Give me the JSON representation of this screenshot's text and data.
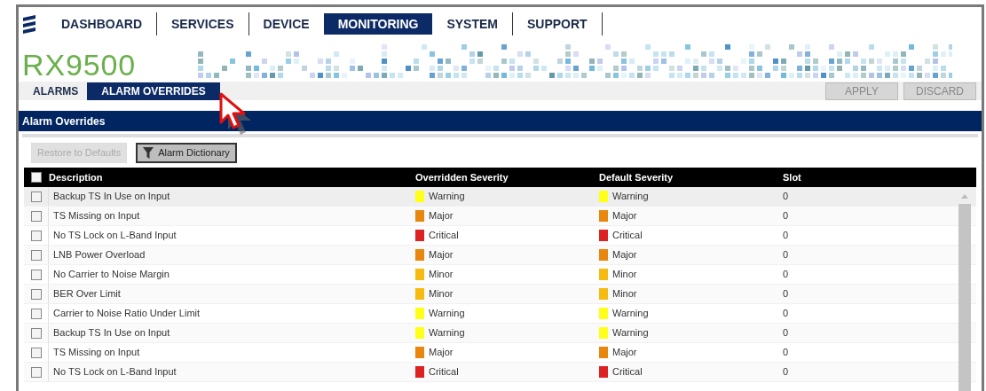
{
  "nav": {
    "tabs": [
      {
        "label": "DASHBOARD",
        "selected": false
      },
      {
        "label": "SERVICES",
        "selected": false
      },
      {
        "label": "DEVICE",
        "selected": false
      },
      {
        "label": "MONITORING",
        "selected": true
      },
      {
        "label": "SYSTEM",
        "selected": false
      },
      {
        "label": "SUPPORT",
        "selected": false
      }
    ]
  },
  "product": "RX9500",
  "subtabs": [
    {
      "label": "ALARMS",
      "selected": false
    },
    {
      "label": "ALARM OVERRIDES",
      "selected": true
    }
  ],
  "actions": [
    {
      "label": "APPLY",
      "disabled": true
    },
    {
      "label": "DISCARD",
      "disabled": true
    }
  ],
  "panel": {
    "title": "Alarm Overrides",
    "toolbar": [
      {
        "label": "Restore to Defaults",
        "disabled": true,
        "kind": "plain"
      },
      {
        "label": "Alarm Dictionary",
        "disabled": false,
        "kind": "filter"
      }
    ],
    "table": {
      "header_checked": false,
      "columns": [
        "Description",
        "Overridden Severity",
        "Default Severity",
        "Slot"
      ],
      "rows": [
        {
          "checked": false,
          "description": "Backup TS In Use on Input",
          "overridden": {
            "label": "Warning",
            "color": "#ffff1a"
          },
          "default": {
            "label": "Warning",
            "color": "#ffff1a"
          },
          "slot": "0"
        },
        {
          "checked": false,
          "description": "TS Missing on Input",
          "overridden": {
            "label": "Major",
            "color": "#e8870e"
          },
          "default": {
            "label": "Major",
            "color": "#e8870e"
          },
          "slot": "0"
        },
        {
          "checked": false,
          "description": "No TS Lock on L-Band Input",
          "overridden": {
            "label": "Critical",
            "color": "#dd2222"
          },
          "default": {
            "label": "Critical",
            "color": "#dd2222"
          },
          "slot": "0"
        },
        {
          "checked": false,
          "description": "LNB Power Overload",
          "overridden": {
            "label": "Major",
            "color": "#e8870e"
          },
          "default": {
            "label": "Major",
            "color": "#e8870e"
          },
          "slot": "0"
        },
        {
          "checked": false,
          "description": "No Carrier to Noise Margin",
          "overridden": {
            "label": "Minor",
            "color": "#f5bb10"
          },
          "default": {
            "label": "Minor",
            "color": "#f5bb10"
          },
          "slot": "0"
        },
        {
          "checked": false,
          "description": "BER Over Limit",
          "overridden": {
            "label": "Minor",
            "color": "#f5bb10"
          },
          "default": {
            "label": "Minor",
            "color": "#f5bb10"
          },
          "slot": "0"
        },
        {
          "checked": false,
          "description": "Carrier to Noise Ratio Under Limit",
          "overridden": {
            "label": "Warning",
            "color": "#ffff1a"
          },
          "default": {
            "label": "Warning",
            "color": "#ffff1a"
          },
          "slot": "0"
        },
        {
          "checked": false,
          "description": "Backup TS In Use on Input",
          "overridden": {
            "label": "Warning",
            "color": "#ffff1a"
          },
          "default": {
            "label": "Warning",
            "color": "#ffff1a"
          },
          "slot": "0"
        },
        {
          "checked": false,
          "description": "TS Missing on Input",
          "overridden": {
            "label": "Major",
            "color": "#e8870e"
          },
          "default": {
            "label": "Major",
            "color": "#e8870e"
          },
          "slot": "0"
        },
        {
          "checked": false,
          "description": "No TS Lock on L-Band Input",
          "overridden": {
            "label": "Critical",
            "color": "#dd2222"
          },
          "default": {
            "label": "Critical",
            "color": "#dd2222"
          },
          "slot": "0"
        }
      ]
    }
  }
}
